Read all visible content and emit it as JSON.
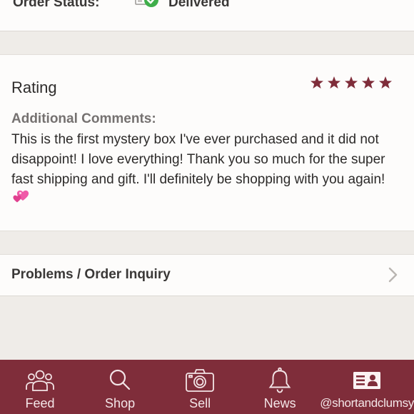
{
  "order": {
    "status_label": "Order Status:",
    "status_value": "Delivered",
    "status_icon": "delivered-check-icon"
  },
  "rating": {
    "title": "Rating",
    "stars": 5,
    "max_stars": 5,
    "star_color": "#7f2d3a",
    "comments_label": "Additional Comments:",
    "comments_text": "This is the first mystery box I've ever purchased and it did not disappoint! I love everything! Thank you so much for the super fast shipping and gift. I'll definitely be shopping with you again!",
    "comments_emoji": "two-hearts-emoji"
  },
  "inquiry": {
    "label": "Problems / Order Inquiry"
  },
  "tabbar": {
    "background": "#7f2d3a",
    "tabs": [
      {
        "label": "Feed",
        "icon": "people-icon"
      },
      {
        "label": "Shop",
        "icon": "search-icon"
      },
      {
        "label": "Sell",
        "icon": "camera-icon"
      },
      {
        "label": "News",
        "icon": "bell-icon"
      },
      {
        "label": "@shortandclumsy",
        "icon": "profile-card-icon"
      }
    ]
  }
}
